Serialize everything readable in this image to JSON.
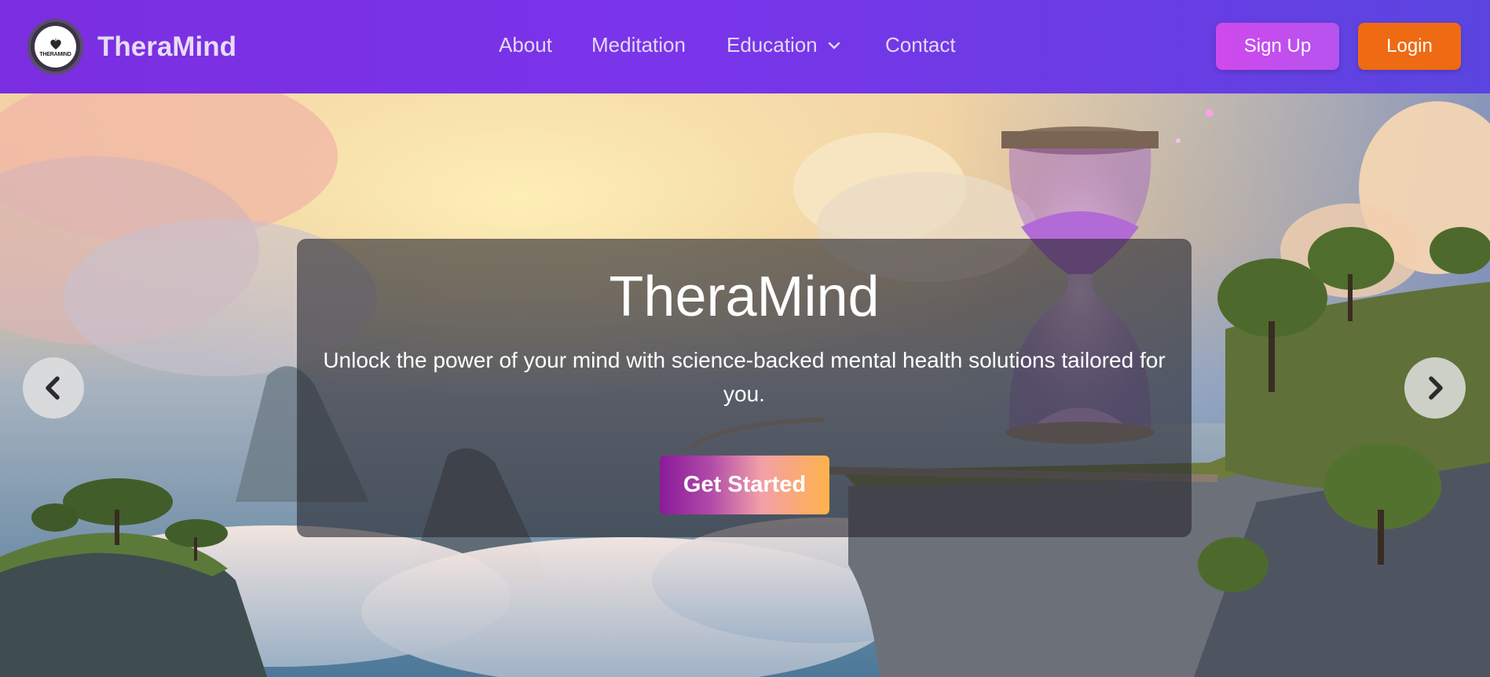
{
  "brand": {
    "name": "TheraMind",
    "logo_text": "THERAMIND"
  },
  "nav": {
    "items": [
      {
        "label": "About"
      },
      {
        "label": "Meditation"
      },
      {
        "label": "Education",
        "icon": "chevron-down-icon"
      },
      {
        "label": "Contact"
      }
    ]
  },
  "actions": {
    "signup_label": "Sign Up",
    "login_label": "Login"
  },
  "hero": {
    "title": "TheraMind",
    "subtitle": "Unlock the power of your mind with science-backed mental health solutions tailored for you.",
    "cta_label": "Get Started",
    "prev_icon": "chevron-left-icon",
    "next_icon": "chevron-right-icon"
  },
  "colors": {
    "nav_gradient_start": "#7b2ee0",
    "nav_gradient_end": "#5a45e0",
    "signup_bg": "#c94cec",
    "login_bg": "#ee6a13"
  }
}
